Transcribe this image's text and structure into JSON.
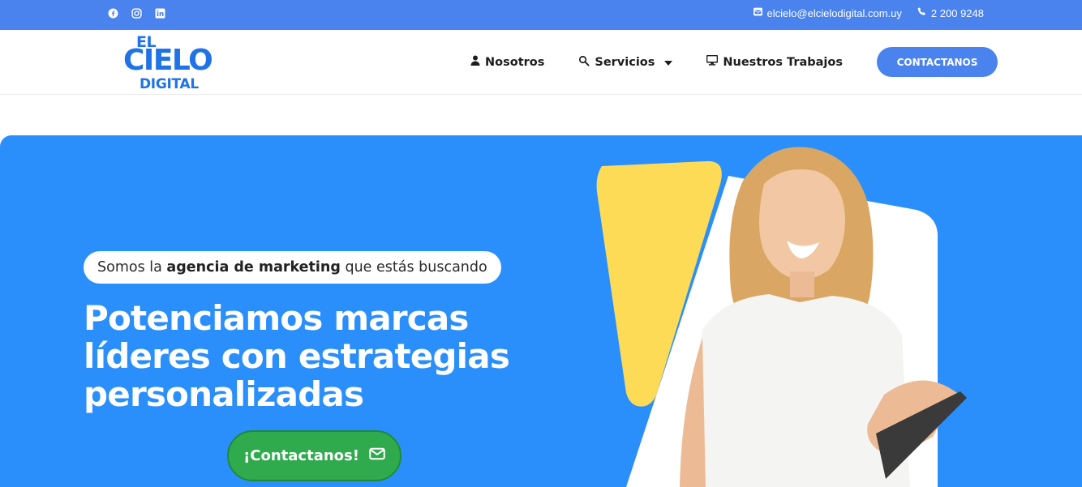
{
  "topbar": {
    "social_icons": [
      "facebook-icon",
      "instagram-icon",
      "linkedin-icon"
    ],
    "email": "elcielo@elcielodigital.com.uy",
    "phone": "2 200 9248"
  },
  "logo": {
    "line1": "EL",
    "line2": "CIELO",
    "line3": "DIGITAL"
  },
  "nav": {
    "items": [
      {
        "label": "Nosotros",
        "icon": "user-icon"
      },
      {
        "label": "Servicios",
        "icon": "search-icon"
      },
      {
        "label": "Nuestros Trabajos",
        "icon": "monitor-icon"
      }
    ],
    "cta_label": "CONTACTANOS"
  },
  "hero": {
    "pill_pre": "Somos la ",
    "pill_bold": "agencia de marketing",
    "pill_post": " que estás buscando",
    "headline_1": "Potenciamos marcas",
    "headline_2": "líderes con ",
    "headline_2_bold": "estrategias",
    "headline_3_bold": "personalizadas",
    "cta_label": "¡Contactanos!"
  },
  "colors": {
    "topbar": "#4a82ee",
    "hero_bg": "#2a8ffb",
    "brand_blue": "#1f73e6",
    "accent_yellow": "#fddb57",
    "cta_green": "#2faa4c"
  }
}
